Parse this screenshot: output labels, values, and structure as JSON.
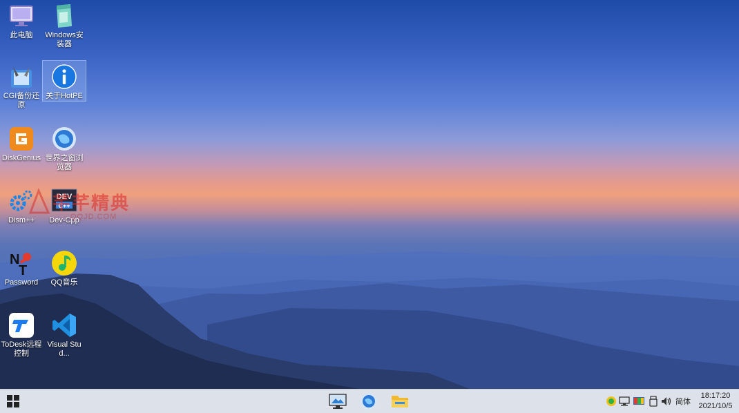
{
  "desktop": {
    "icons": [
      {
        "label": "此电脑",
        "icon": "computer-icon"
      },
      {
        "label": "Windows安装器",
        "icon": "windows-installer-icon"
      },
      {
        "label": "CGI备份还原",
        "icon": "cgi-backup-icon"
      },
      {
        "label": "关于HotPE",
        "icon": "info-icon",
        "selected": true
      },
      {
        "label": "DiskGenius",
        "icon": "diskgenius-icon"
      },
      {
        "label": "世界之窗浏览器",
        "icon": "theworld-browser-icon"
      },
      {
        "label": "Dism++",
        "icon": "dism-icon"
      },
      {
        "label": "Dev-Cpp",
        "icon": "devcpp-icon"
      },
      {
        "label": "Password",
        "icon": "password-icon"
      },
      {
        "label": "QQ音乐",
        "icon": "qqmusic-icon"
      },
      {
        "label": "ToDesk远程控制",
        "icon": "todesk-icon"
      },
      {
        "label": "Visual Stud...",
        "icon": "vscode-icon"
      }
    ]
  },
  "watermark": {
    "text": "芊芊精典",
    "url": "QQJD.COM"
  },
  "taskbar": {
    "start_icon": "windows-logo-icon",
    "pinned": [
      "remote-desktop-icon",
      "globe-browser-icon",
      "file-explorer-icon"
    ],
    "tray": [
      "shield-status-icon",
      "network-icon",
      "display-icon",
      "usb-icon",
      "volume-icon"
    ],
    "ime": "简体",
    "time": "18:17:20",
    "date": "2021/10/5"
  },
  "colors": {
    "taskbar": "#dde2ea",
    "selection": "#b4d2ff",
    "label_text": "#ffffff"
  }
}
